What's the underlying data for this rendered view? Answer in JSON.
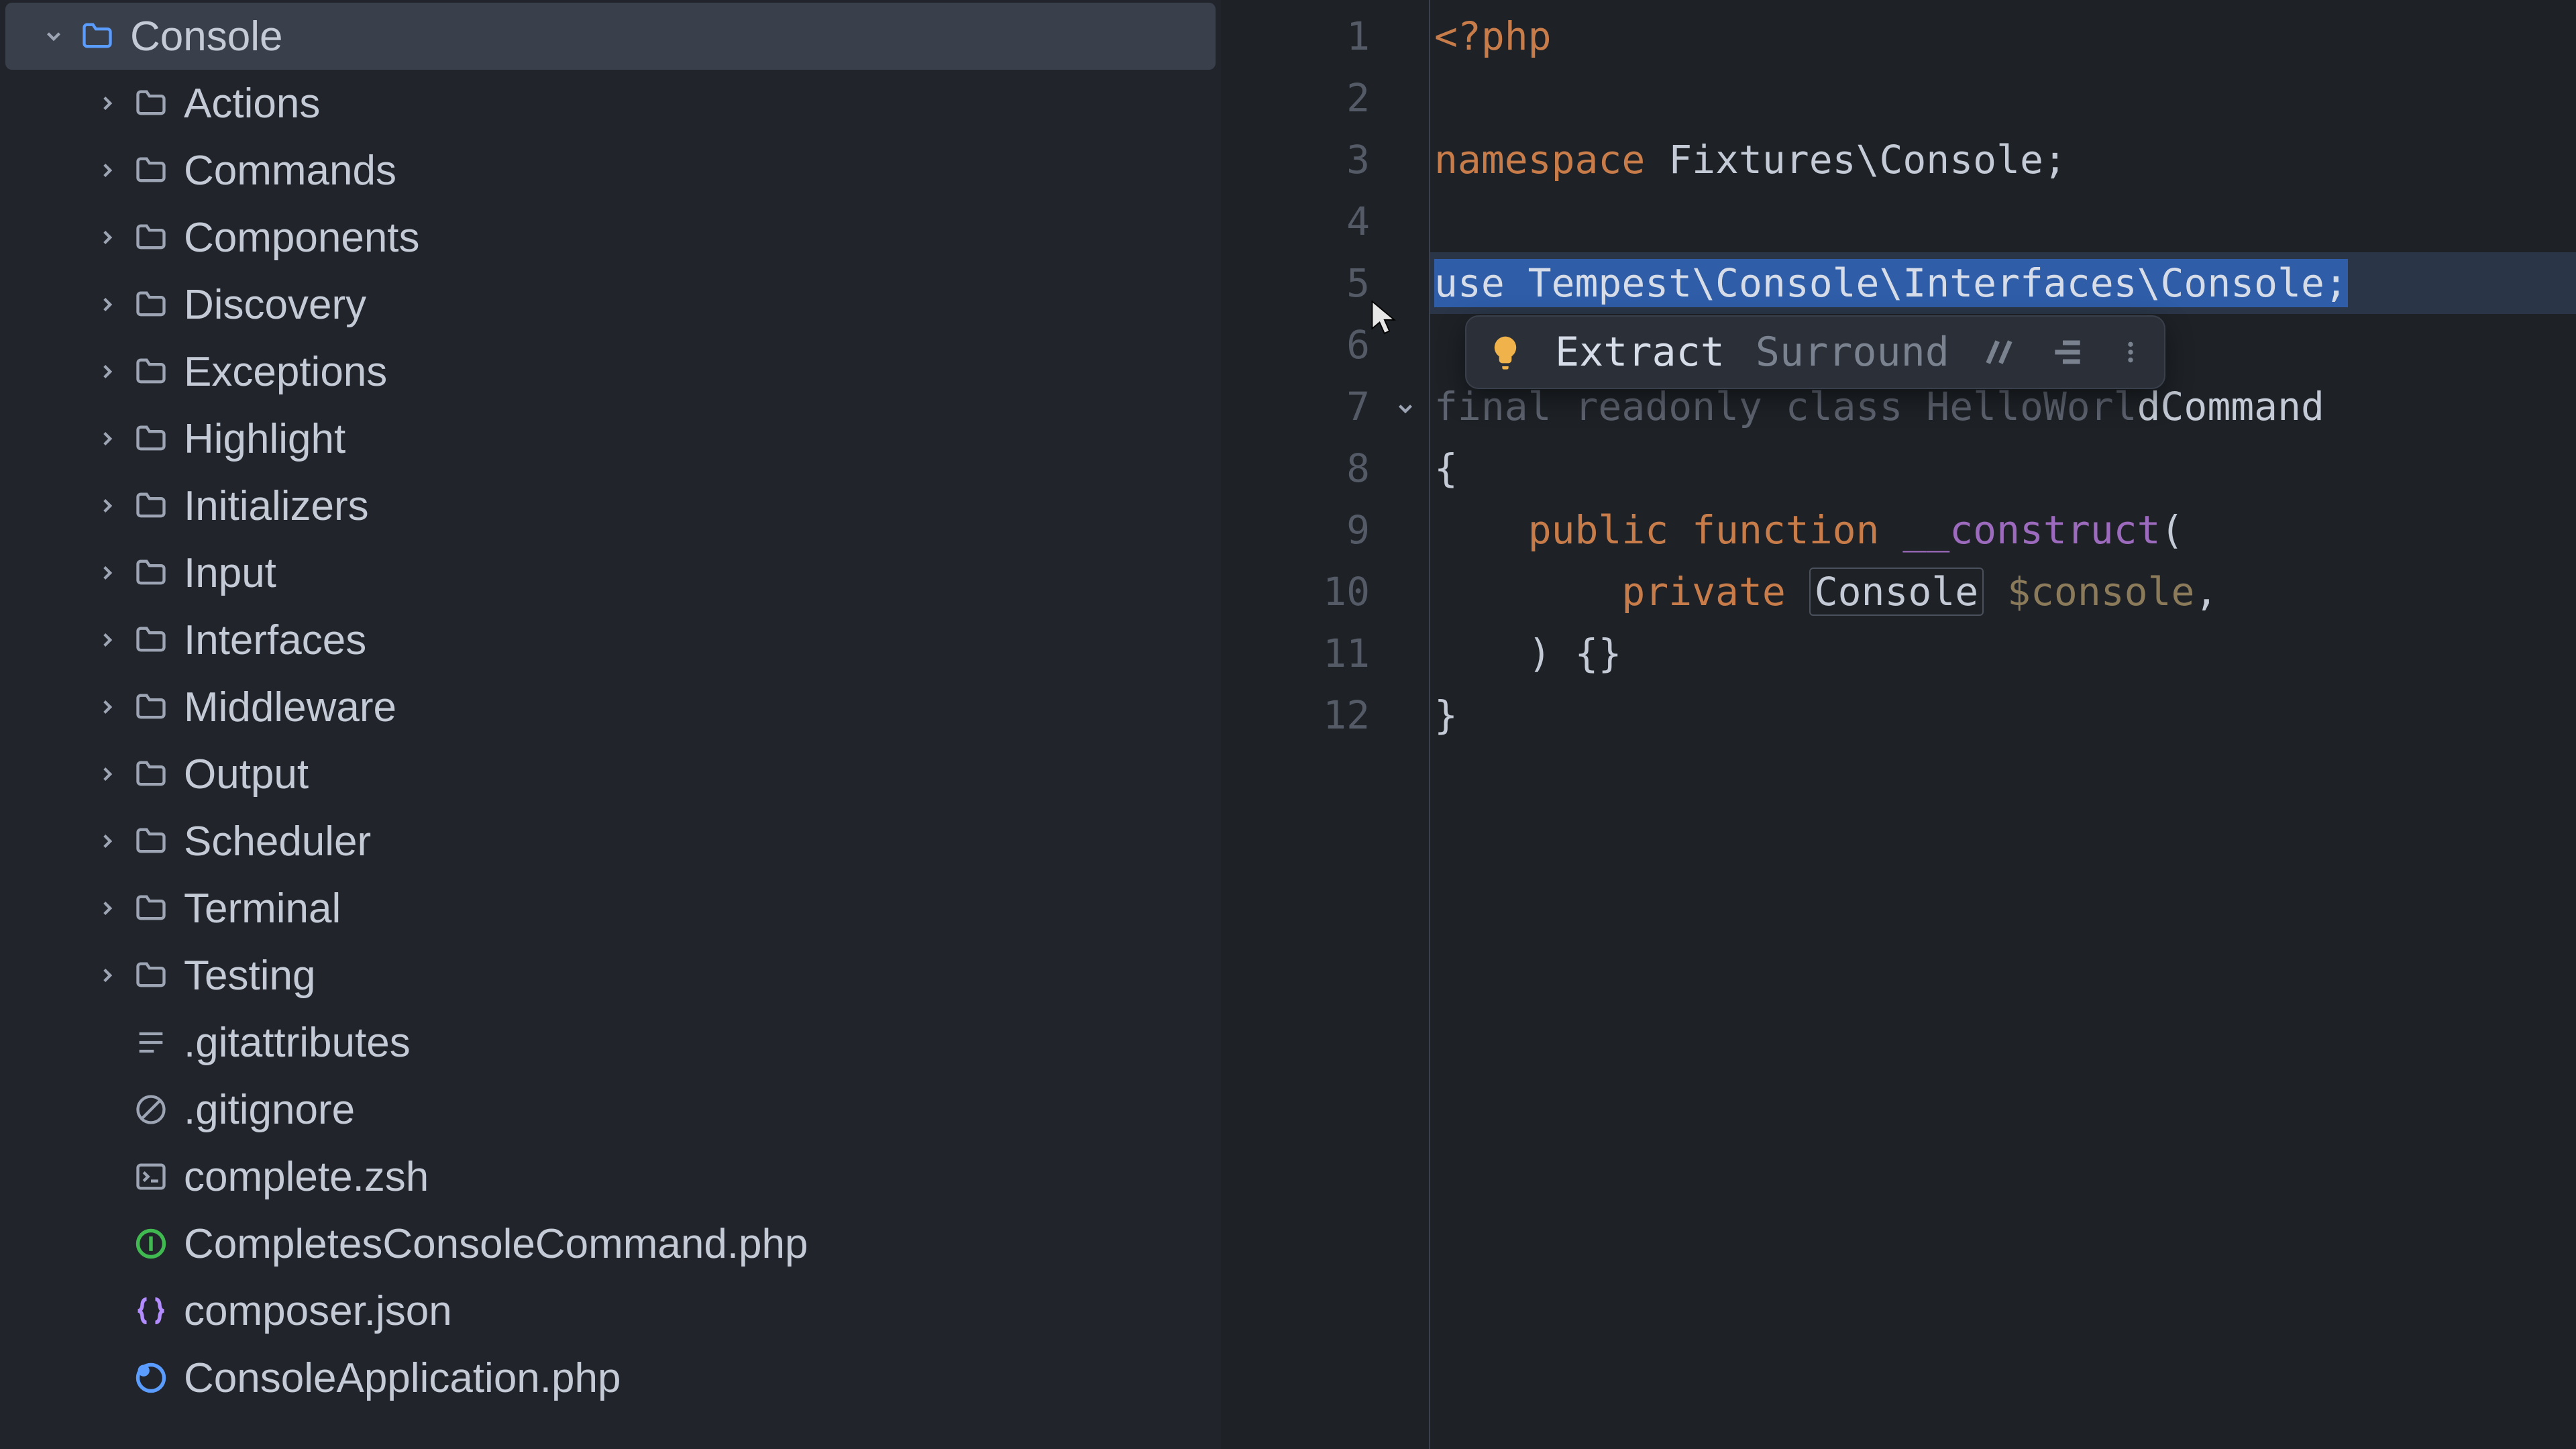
{
  "sidebar": {
    "root": {
      "label": "Console"
    },
    "folders": [
      {
        "label": "Actions"
      },
      {
        "label": "Commands"
      },
      {
        "label": "Components"
      },
      {
        "label": "Discovery"
      },
      {
        "label": "Exceptions"
      },
      {
        "label": "Highlight"
      },
      {
        "label": "Initializers"
      },
      {
        "label": "Input"
      },
      {
        "label": "Interfaces"
      },
      {
        "label": "Middleware"
      },
      {
        "label": "Output"
      },
      {
        "label": "Scheduler"
      },
      {
        "label": "Terminal"
      },
      {
        "label": "Testing"
      }
    ],
    "files": [
      {
        "label": ".gitattributes",
        "icon": "lines"
      },
      {
        "label": ".gitignore",
        "icon": "slash"
      },
      {
        "label": "complete.zsh",
        "icon": "term"
      },
      {
        "label": "CompletesConsoleCommand.php",
        "icon": "interface"
      },
      {
        "label": "composer.json",
        "icon": "json"
      },
      {
        "label": "ConsoleApplication.php",
        "icon": "php"
      }
    ]
  },
  "gutter": {
    "lines": [
      "1",
      "2",
      "3",
      "4",
      "5",
      "6",
      "7",
      "8",
      "9",
      "10",
      "11",
      "12"
    ]
  },
  "code": {
    "l1_open": "<?php",
    "l3_ns_kw": "namespace",
    "l3_ns_name": " Fixtures\\Console;",
    "l5_use": "use Tempest\\Console\\Interfaces\\Console;",
    "l7_obscured_pre": "final readonly class HelloWorl",
    "l7_visible_tail": "dCommand",
    "l8_brace": "{",
    "l9_pub": "public",
    "l9_fn": " function ",
    "l9_ctor": "__construct",
    "l9_paren": "(",
    "l10_priv": "private",
    "l10_type": "Console",
    "l10_var": " $console",
    "l10_comma": ",",
    "l11_close": ") {}",
    "l12_brace": "}"
  },
  "popup": {
    "extract": "Extract",
    "surround": "Surround"
  }
}
